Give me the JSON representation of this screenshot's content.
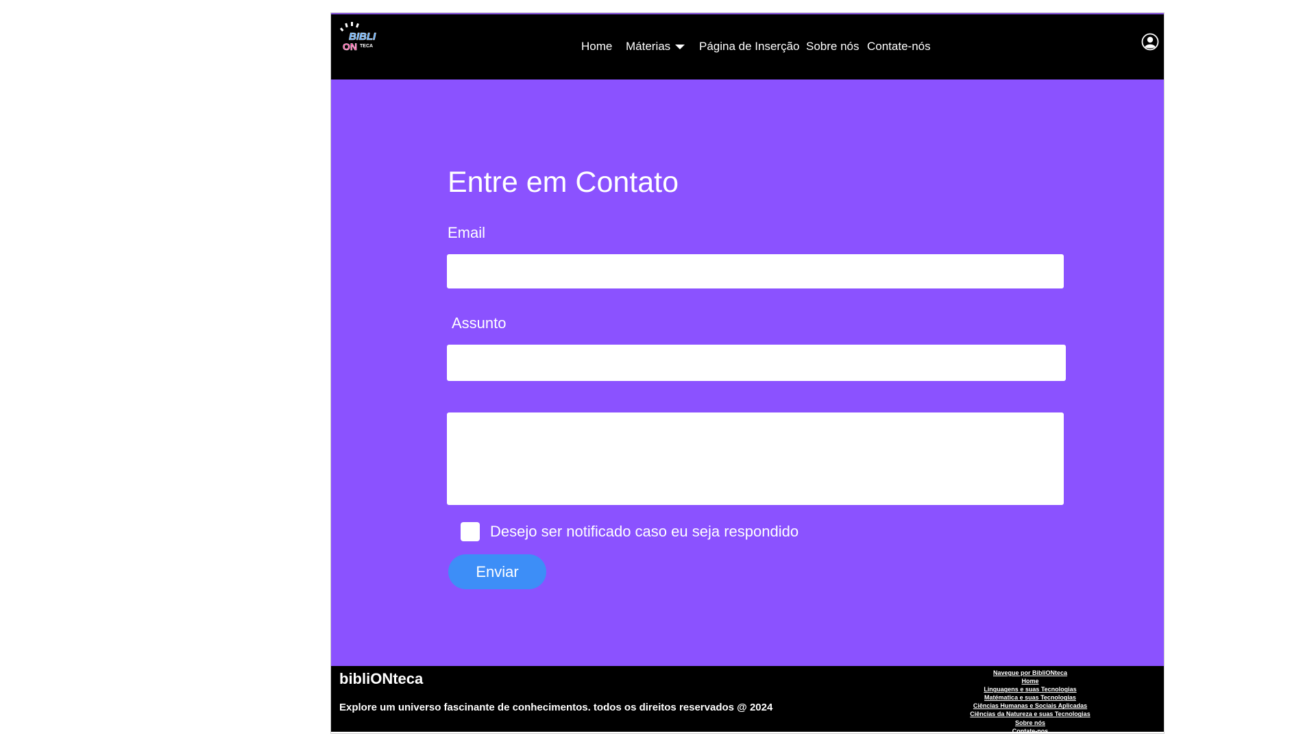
{
  "header": {
    "logo_text": {
      "top": "BIBLI",
      "on": "ON",
      "sub": "TECA"
    },
    "nav": {
      "home": "Home",
      "materias": "Máterias",
      "insercao": "Página de Inserção",
      "sobre": "Sobre nós",
      "contato": "Contate-nós"
    },
    "user_icon": "user-circle-icon"
  },
  "form": {
    "title": "Entre em Contato",
    "email_label": "Email",
    "email_value": "",
    "assunto_label": "Assunto",
    "assunto_value": "",
    "message_value": "",
    "notify_label": "Desejo ser notificado caso eu seja respondido",
    "notify_checked": false,
    "submit_label": "Enviar"
  },
  "footer": {
    "brand": "bibliONteca",
    "tagline": "Explore um universo fascinante de conhecimentos. todos os direitos reservados @ 2024",
    "links_title": "Navegue por BibliONteca",
    "links": [
      "Home",
      "Linguagens e suas Tecnologias",
      "Matématica e suas Tecnologias",
      "Ciências Humanas e Sociais Aplicadas",
      "Ciências da Natureza e suas Tecnologias",
      "Sobre nós",
      "Contate-nos"
    ]
  },
  "colors": {
    "header_bg": "#000000",
    "hero_bg": "#8b52ff",
    "button_bg": "#3d8ef7",
    "logo_blue": "#4aa3ff",
    "logo_pink": "#ff3d9a"
  }
}
